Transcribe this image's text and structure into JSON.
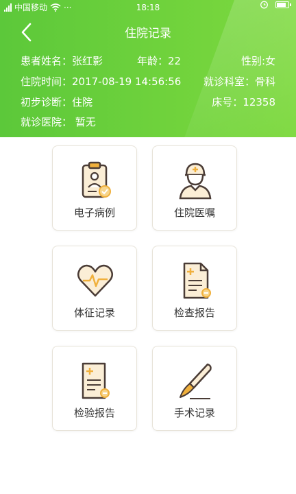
{
  "status_bar": {
    "carrier": "中国移动",
    "dots": "···",
    "time": "18:18"
  },
  "header": {
    "title": "住院记录"
  },
  "patient": {
    "name": "患者姓名：张红影",
    "age": "年龄：22",
    "gender": "性别:女",
    "admit_time": "住院时间：2017-08-19 14:56:56",
    "department": "就诊科室：骨科",
    "diagnosis": "初步诊断：住院",
    "bed": "床号：12358",
    "hospital": "就诊医院：  暂无"
  },
  "menu": [
    {
      "label": "电子病例",
      "icon": "clipboard-avatar-icon"
    },
    {
      "label": "住院医嘱",
      "icon": "doctor-icon"
    },
    {
      "label": "体征记录",
      "icon": "heart-pulse-icon"
    },
    {
      "label": "检查报告",
      "icon": "report-document-icon"
    },
    {
      "label": "检验报告",
      "icon": "lab-report-icon"
    },
    {
      "label": "手术记录",
      "icon": "scalpel-icon"
    }
  ],
  "colors": {
    "header_green": "#6fd23c",
    "icon_orange": "#f0b03c",
    "icon_dark": "#4a3c36",
    "icon_fill": "#fbeed6"
  }
}
